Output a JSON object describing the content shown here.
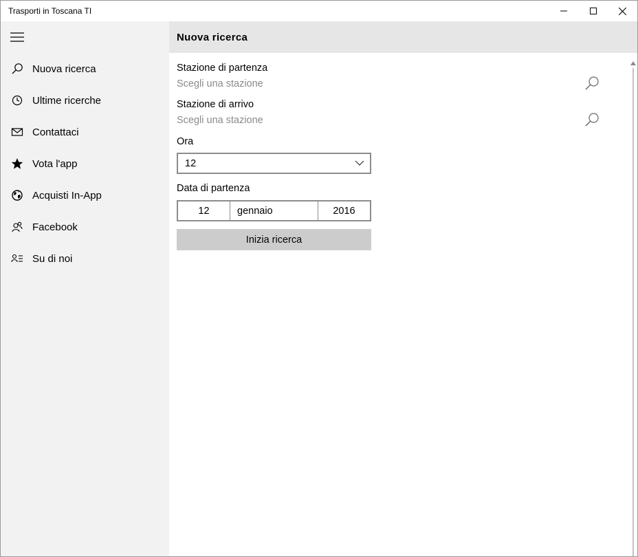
{
  "window": {
    "title": "Trasporti in Toscana TI"
  },
  "sidebar": {
    "items": [
      {
        "label": "Nuova ricerca",
        "icon": "search-icon"
      },
      {
        "label": "Ultime ricerche",
        "icon": "clock-icon"
      },
      {
        "label": "Contattaci",
        "icon": "mail-icon"
      },
      {
        "label": "Vota l'app",
        "icon": "star-icon"
      },
      {
        "label": "Acquisti In-App",
        "icon": "globe-icon"
      },
      {
        "label": "Facebook",
        "icon": "people-icon"
      },
      {
        "label": "Su di noi",
        "icon": "contact-info-icon"
      }
    ]
  },
  "main": {
    "title": "Nuova ricerca",
    "departure": {
      "label": "Stazione di partenza",
      "placeholder": "Scegli una stazione"
    },
    "arrival": {
      "label": "Stazione di arrivo",
      "placeholder": "Scegli una stazione"
    },
    "hour": {
      "label": "Ora",
      "value": "12"
    },
    "date": {
      "label": "Data di partenza",
      "day": "12",
      "month": "gennaio",
      "year": "2016"
    },
    "search_button": "Inizia ricerca"
  },
  "colors": {
    "sidebar_bg": "#f2f2f2",
    "header_bg": "#e6e6e6",
    "button_bg": "#cccccc",
    "placeholder": "#8a8a8a"
  }
}
